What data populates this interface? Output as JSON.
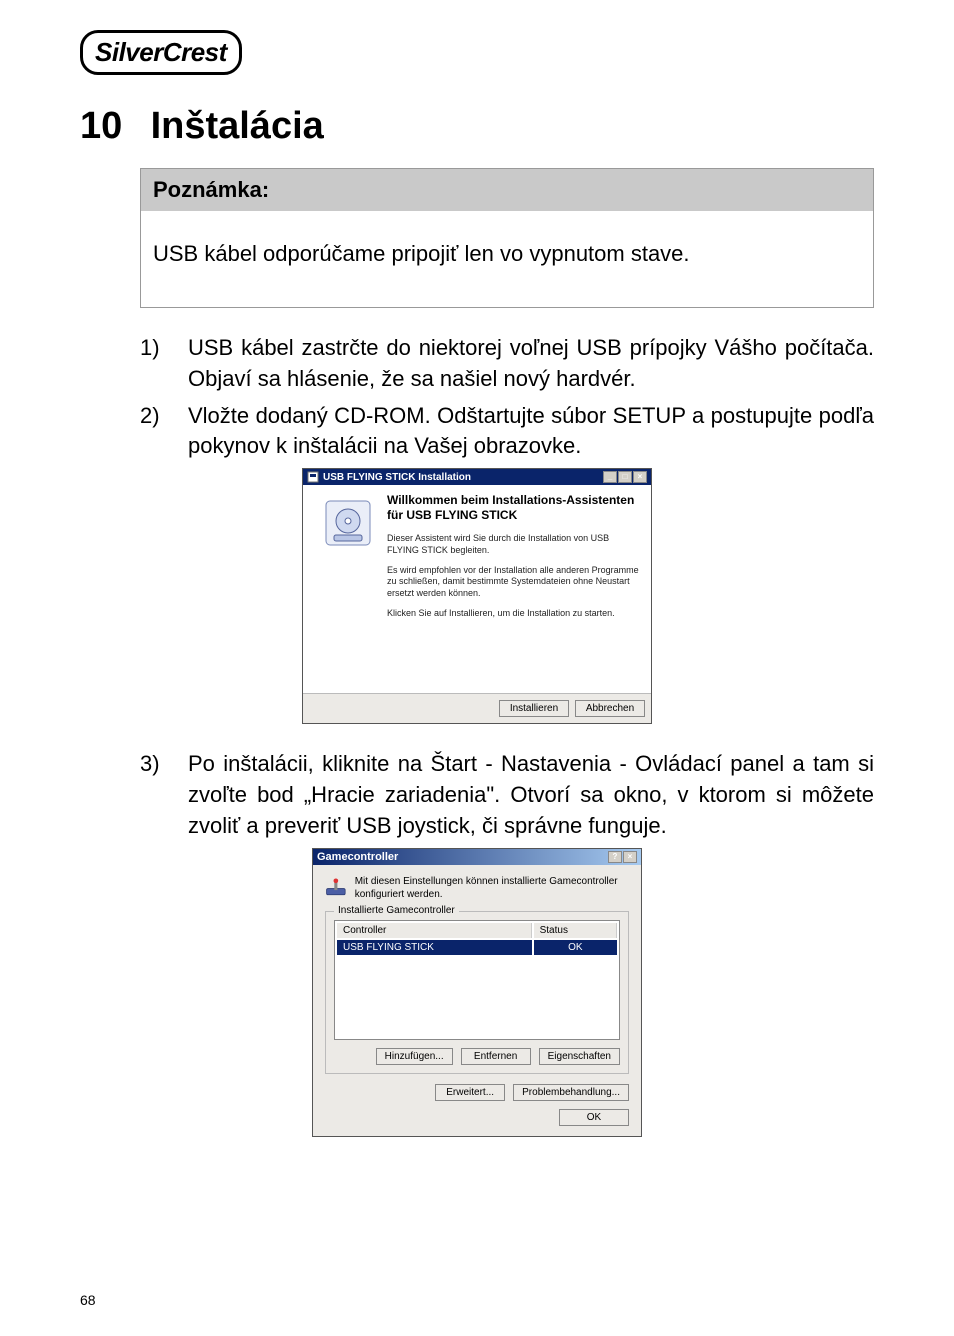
{
  "brand": {
    "logo_text": "SilverCrest"
  },
  "heading": {
    "number": "10",
    "title": "Inštalácia"
  },
  "note": {
    "header": "Poznámka:",
    "body": "USB kábel odporúčame pripojiť len vo vypnutom stave."
  },
  "steps": {
    "item1": {
      "marker": "1)",
      "text": "USB kábel zastrčte do niektorej voľnej USB prípojky Vášho počítača. Objaví sa hlásenie, že sa našiel nový hardvér."
    },
    "item2": {
      "marker": "2)",
      "text": "Vložte dodaný CD-ROM. Odštartujte súbor SETUP a postupujte podľa pokynov k inštalácii na Vašej obrazovke."
    },
    "item3": {
      "marker": "3)",
      "text": "Po inštalácii, kliknite na Štart - Nastavenia - Ovládací panel a tam si zvoľte bod „Hracie zariadenia\". Otvorí sa okno, v ktorom si môžete zvoliť a preveriť USB joystick, či správne funguje."
    }
  },
  "dialog1": {
    "title": "USB FLYING STICK Installation",
    "heading": "Willkommen beim Installations-Assistenten für USB FLYING STICK",
    "p1": "Dieser Assistent wird Sie durch die Installation von USB FLYING STICK begleiten.",
    "p2": "Es wird empfohlen vor der Installation alle anderen Programme zu schließen, damit bestimmte Systemdateien ohne Neustart ersetzt werden können.",
    "p3": "Klicken Sie auf Installieren, um die Installation zu starten.",
    "btn_install": "Installieren",
    "btn_cancel": "Abbrechen"
  },
  "dialog2": {
    "title": "Gamecontroller",
    "desc": "Mit diesen Einstellungen können installierte Gamecontroller konfiguriert werden.",
    "legend": "Installierte Gamecontroller",
    "col_controller": "Controller",
    "col_status": "Status",
    "row_controller": "USB FLYING STICK",
    "row_status": "OK",
    "btn_add": "Hinzufügen...",
    "btn_remove": "Entfernen",
    "btn_props": "Eigenschaften",
    "btn_adv": "Erweitert...",
    "btn_trouble": "Problembehandlung...",
    "btn_ok": "OK"
  },
  "page_number": "68"
}
